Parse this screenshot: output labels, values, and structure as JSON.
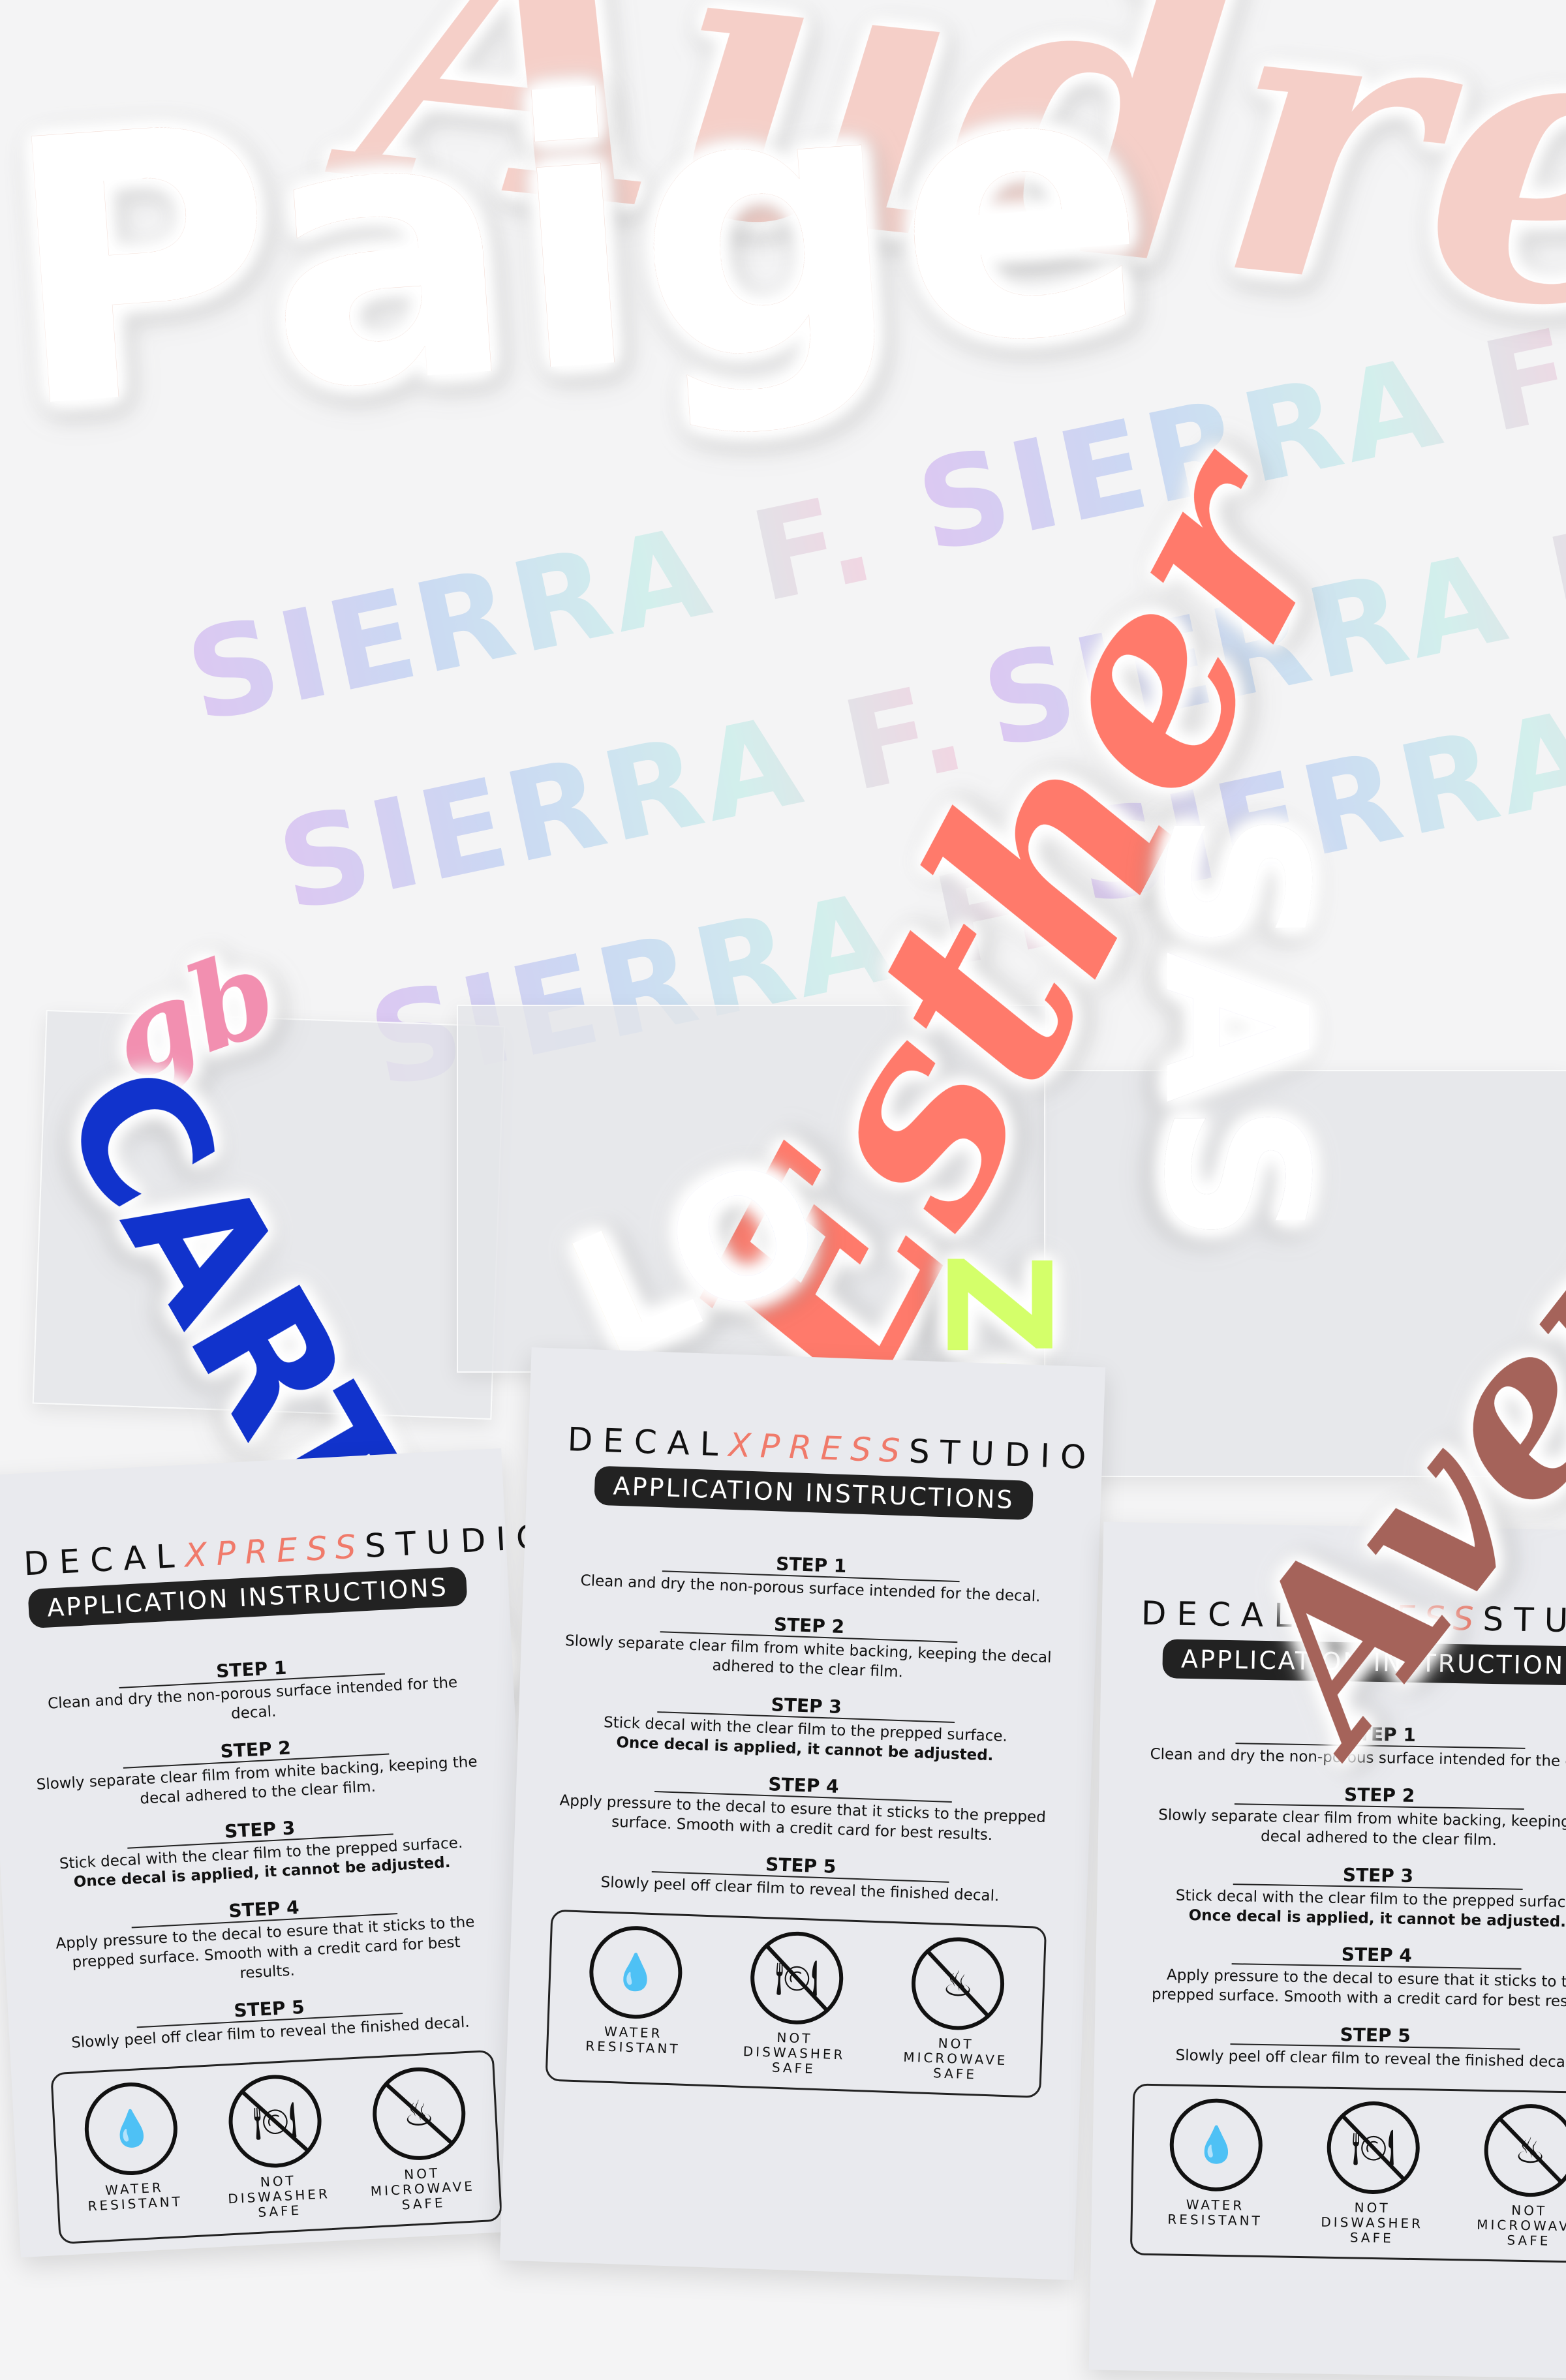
{
  "decals": {
    "paige": "Paige",
    "audrey": "Audrey",
    "sierra": "SIERRA F.",
    "esther": "Esther",
    "sas": "SAS",
    "carter": "CARTER",
    "lo": "LO",
    "zoe": "ZOE",
    "avery": "Avery",
    "gb": "gb"
  },
  "card": {
    "brand_a": "DECAL",
    "brand_x": "XPRESS",
    "brand_b": "STUDIO",
    "title": "APPLICATION INSTRUCTIONS",
    "steps": [
      {
        "h": "STEP 1",
        "t": "Clean and dry the non-porous surface intended for the decal."
      },
      {
        "h": "STEP 2",
        "t": "Slowly separate clear film from white backing, keeping the decal adhered to the clear film."
      },
      {
        "h": "STEP 3",
        "t": "Stick decal with the clear film to the prepped surface.",
        "b": "Once decal is applied, it cannot be adjusted."
      },
      {
        "h": "STEP 4",
        "t": "Apply pressure to the decal to esure that it sticks to the prepped surface. Smooth with a credit card for best results."
      },
      {
        "h": "STEP 5",
        "t": "Slowly peel off clear film to reveal the finished decal."
      }
    ],
    "icons": [
      {
        "name": "water-drop-icon",
        "label": "WATER\nRESISTANT"
      },
      {
        "name": "dishwasher-icon",
        "label": "NOT\nDISWASHER\nSAFE"
      },
      {
        "name": "microwave-icon",
        "label": "NOT\nMICROWAVE\nSAFE"
      }
    ]
  },
  "colors": {
    "accent": "#f07a6a",
    "coral": "#ff7a6b",
    "blue": "#1133cc",
    "lime": "#d4ff6a",
    "rose": "#a5635a",
    "blush": "#f5cfc8"
  }
}
